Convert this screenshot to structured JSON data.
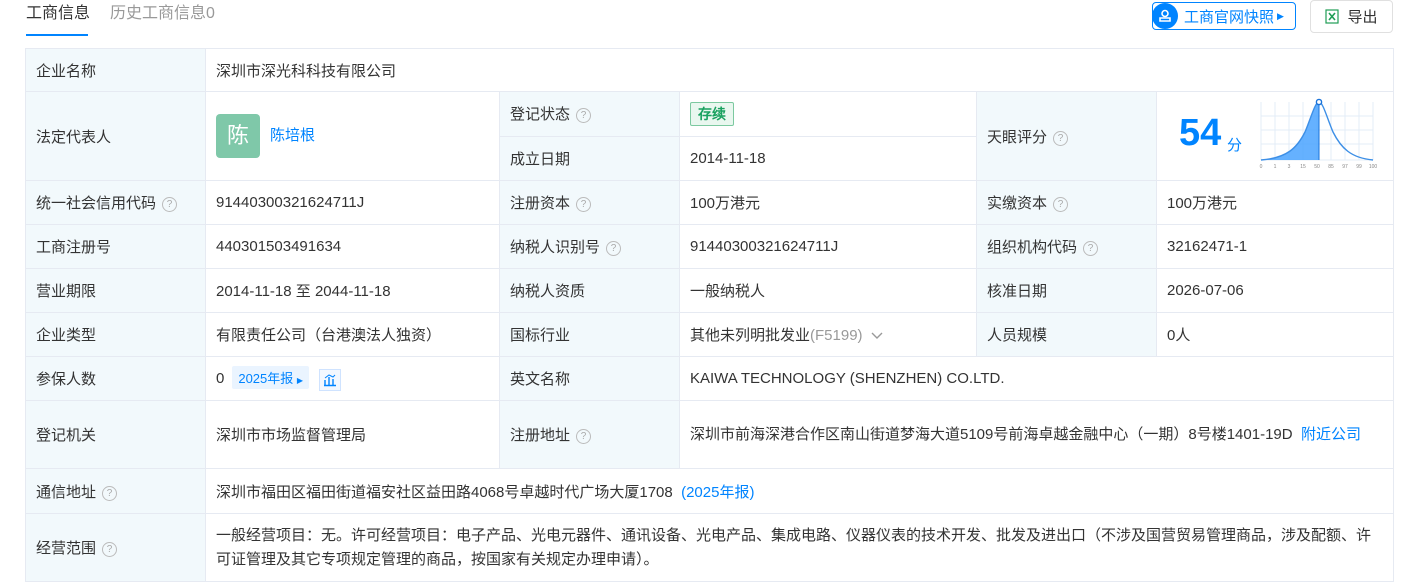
{
  "tabs": {
    "active": "工商信息",
    "inactive": "历史工商信息0"
  },
  "toolbar": {
    "snapshot_label": "工商官网快照",
    "export_label": "导出"
  },
  "colors": {
    "accent": "#0084ff",
    "label_bg": "#f2f9fc",
    "status_green": "#19a15f",
    "avatar": "#7fc8a9"
  },
  "rows": {
    "company_name": {
      "label": "企业名称",
      "value": "深圳市深光科科技有限公司"
    },
    "legal_rep": {
      "label": "法定代表人",
      "avatar": "陈",
      "name": "陈培根"
    },
    "reg_status": {
      "label": "登记状态",
      "value": "存续"
    },
    "found_date": {
      "label": "成立日期",
      "value": "2014-11-18"
    },
    "score": {
      "label": "天眼评分",
      "value": "54",
      "unit": "分"
    },
    "credit_code": {
      "label": "统一社会信用代码",
      "value": "91440300321624711J"
    },
    "reg_capital": {
      "label": "注册资本",
      "value": "100万港元"
    },
    "paid_capital": {
      "label": "实缴资本",
      "value": "100万港元"
    },
    "biz_reg_no": {
      "label": "工商注册号",
      "value": "440301503491634"
    },
    "taxpayer_id": {
      "label": "纳税人识别号",
      "value": "91440300321624711J"
    },
    "org_code": {
      "label": "组织机构代码",
      "value": "32162471-1"
    },
    "biz_term": {
      "label": "营业期限",
      "value": "2014-11-18 至 2044-11-18"
    },
    "taxpayer_qual": {
      "label": "纳税人资质",
      "value": "一般纳税人"
    },
    "approve_date": {
      "label": "核准日期",
      "value": "2026-07-06"
    },
    "company_type": {
      "label": "企业类型",
      "value": "有限责任公司（台港澳法人独资）"
    },
    "industry": {
      "label": "国标行业",
      "value": "其他未列明批发业",
      "code": "(F5199)"
    },
    "staff_size": {
      "label": "人员规模",
      "value": "0人"
    },
    "insured": {
      "label": "参保人数",
      "value": "0",
      "report": "2025年报"
    },
    "english_name": {
      "label": "英文名称",
      "value": "KAIWA TECHNOLOGY (SHENZHEN) CO.LTD."
    },
    "reg_authority": {
      "label": "登记机关",
      "value": "深圳市市场监督管理局"
    },
    "reg_address": {
      "label": "注册地址",
      "value": "深圳市前海深港合作区南山街道梦海大道5109号前海卓越金融中心（一期）8号楼1401-19D",
      "nearby": "附近公司"
    },
    "mail_address": {
      "label": "通信地址",
      "value": "深圳市福田区福田街道福安社区益田路4068号卓越时代广场大厦1708",
      "report": "(2025年报)"
    },
    "scope": {
      "label": "经营范围",
      "value": "一般经营项目：无。许可经营项目：电子产品、光电元器件、通讯设备、光电产品、集成电路、仪器仪表的技术开发、批发及进出口（不涉及国营贸易管理商品，涉及配额、许可证管理及其它专项规定管理的商品，按国家有关规定办理申请）。"
    }
  },
  "score_chart": {
    "ticks": [
      "0",
      "1",
      "3",
      "15",
      "50",
      "85",
      "97",
      "99",
      "100"
    ],
    "marker_value": 54
  }
}
